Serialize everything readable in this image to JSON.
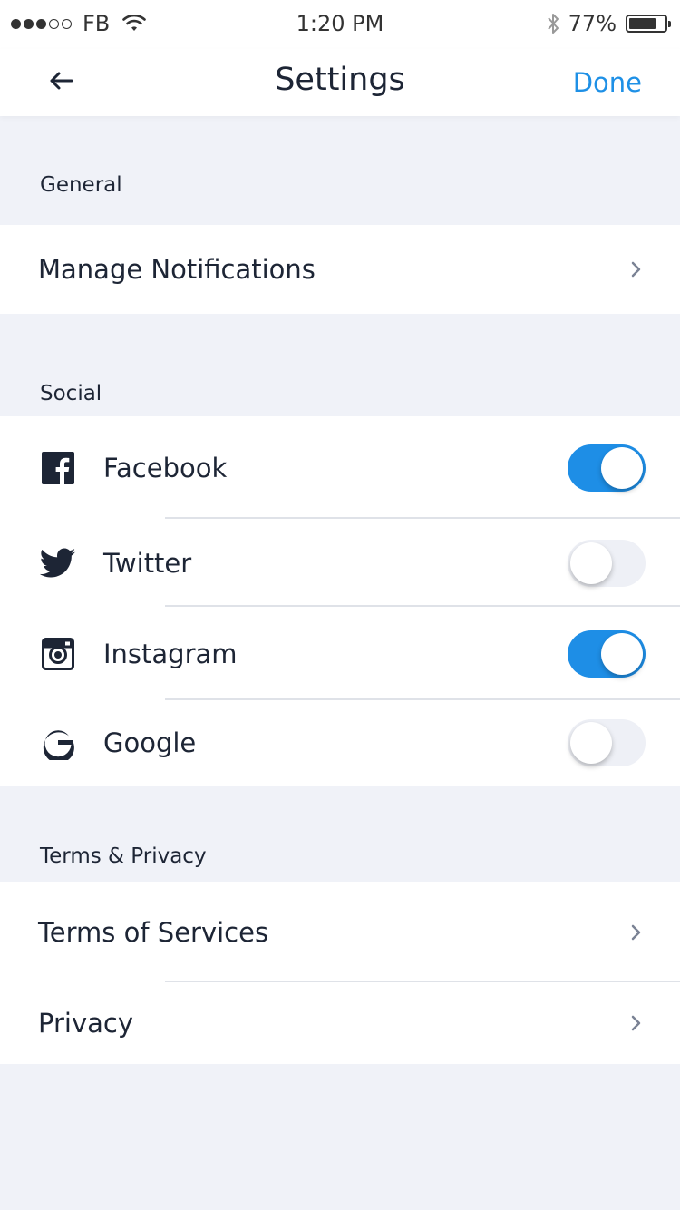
{
  "status_bar": {
    "carrier": "FB",
    "time": "1:20 PM",
    "battery_percent": "77%",
    "battery_level": 0.77,
    "signal_bars_filled": 3,
    "signal_bars_total": 5
  },
  "nav": {
    "title": "Settings",
    "done_label": "Done",
    "back_icon": "arrow-left-icon"
  },
  "colors": {
    "accent": "#1e90e6",
    "toggle_on": "#1e8ee6",
    "background": "#f0f2f8",
    "text": "#1d2535"
  },
  "sections": {
    "general": {
      "header": "General",
      "items": [
        {
          "label": "Manage Notifications",
          "icon": "chevron-right-icon"
        }
      ]
    },
    "social": {
      "header": "Social",
      "items": [
        {
          "label": "Facebook",
          "icon": "facebook-icon",
          "enabled": true
        },
        {
          "label": "Twitter",
          "icon": "twitter-icon",
          "enabled": false
        },
        {
          "label": "Instagram",
          "icon": "instagram-icon",
          "enabled": true
        },
        {
          "label": "Google",
          "icon": "google-icon",
          "enabled": false
        }
      ]
    },
    "terms": {
      "header": "Terms & Privacy",
      "items": [
        {
          "label": "Terms of Services",
          "icon": "chevron-right-icon"
        },
        {
          "label": "Privacy",
          "icon": "chevron-right-icon"
        }
      ]
    }
  }
}
